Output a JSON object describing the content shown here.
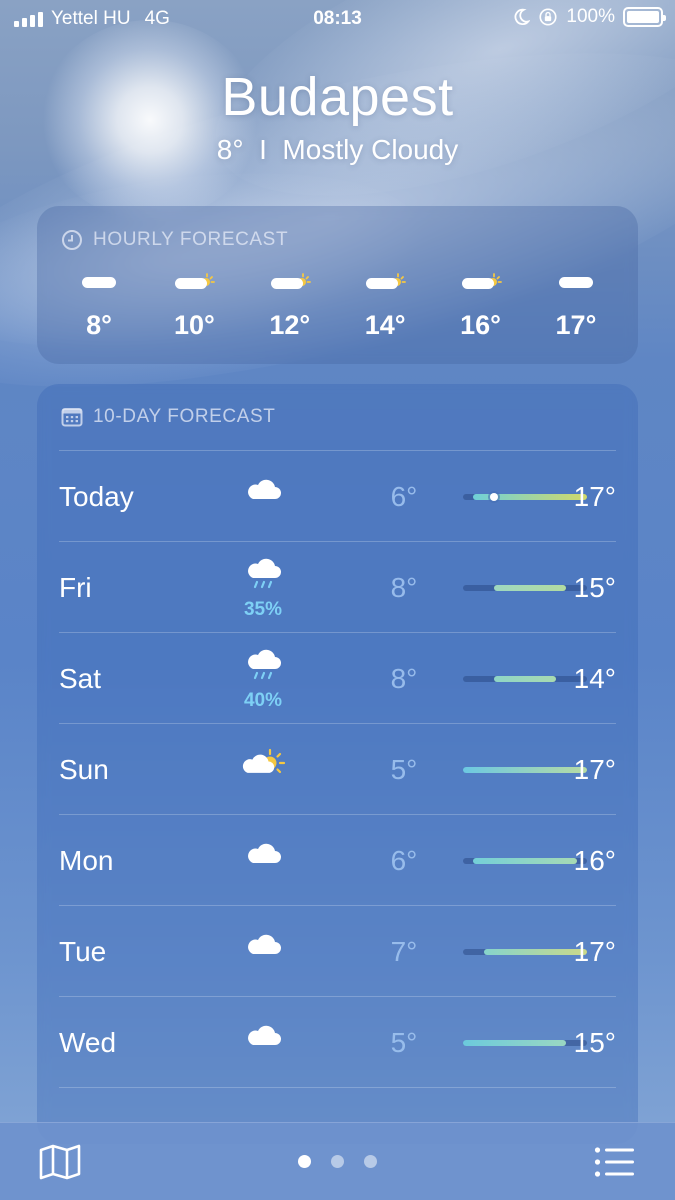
{
  "status_bar": {
    "carrier": "Yettel HU",
    "network": "4G",
    "time": "08:13",
    "battery": "100%",
    "icons": [
      "signal-icon",
      "moon-icon",
      "rotation-lock-icon",
      "battery-icon"
    ]
  },
  "location": {
    "city": "Budapest",
    "conditions": "8°  I  Mostly Cloudy"
  },
  "hourly": {
    "title": "HOURLY FORECAST",
    "items": [
      {
        "icon": "cloud-icon",
        "temp": "8°"
      },
      {
        "icon": "partly-sunny-icon",
        "temp": "10°"
      },
      {
        "icon": "partly-sunny-icon",
        "temp": "12°"
      },
      {
        "icon": "partly-sunny-icon",
        "temp": "14°"
      },
      {
        "icon": "partly-sunny-icon",
        "temp": "16°"
      },
      {
        "icon": "cloud-icon",
        "temp": "17°"
      }
    ]
  },
  "daily": {
    "title": "10-DAY FORECAST",
    "range": {
      "min": 5,
      "max": 17
    },
    "current_temp": 8,
    "days": [
      {
        "day": "Today",
        "icon": "cloud-icon",
        "pop": "",
        "low": "6°",
        "high": "17°",
        "low_val": 6,
        "high_val": 17,
        "colors": [
          "#6fd0d8",
          "#d2d96a"
        ],
        "show_now": true
      },
      {
        "day": "Fri",
        "icon": "rain-cloud-icon",
        "pop": "35%",
        "low": "8°",
        "high": "15°",
        "low_val": 8,
        "high_val": 15,
        "colors": [
          "#9ed8c0",
          "#b3dba0"
        ],
        "show_now": false
      },
      {
        "day": "Sat",
        "icon": "rain-cloud-icon",
        "pop": "40%",
        "low": "8°",
        "high": "14°",
        "low_val": 8,
        "high_val": 14,
        "colors": [
          "#8fd5c6",
          "#a9dab0"
        ],
        "show_now": false
      },
      {
        "day": "Sun",
        "icon": "partly-sunny-icon",
        "pop": "",
        "low": "5°",
        "high": "17°",
        "low_val": 5,
        "high_val": 17,
        "colors": [
          "#6cc8e2",
          "#b6dba4"
        ],
        "show_now": false
      },
      {
        "day": "Mon",
        "icon": "cloud-icon",
        "pop": "",
        "low": "6°",
        "high": "16°",
        "low_val": 6,
        "high_val": 16,
        "colors": [
          "#74cfd8",
          "#a6dab4"
        ],
        "show_now": false
      },
      {
        "day": "Tue",
        "icon": "cloud-icon",
        "pop": "",
        "low": "7°",
        "high": "17°",
        "low_val": 7,
        "high_val": 17,
        "colors": [
          "#86d4cc",
          "#cad98a"
        ],
        "show_now": false
      },
      {
        "day": "Wed",
        "icon": "cloud-icon",
        "pop": "",
        "low": "5°",
        "high": "15°",
        "low_val": 5,
        "high_val": 15,
        "colors": [
          "#6ccadc",
          "#9ad7c2"
        ],
        "show_now": false
      }
    ]
  },
  "bottom_bar": {
    "map_icon": "map-icon",
    "list_icon": "list-icon",
    "pages": 3,
    "active_page": 0
  },
  "colors": {
    "pop": "#7ed0f5",
    "low_temp": "#a0c3f0",
    "sun": "#f5c842"
  }
}
